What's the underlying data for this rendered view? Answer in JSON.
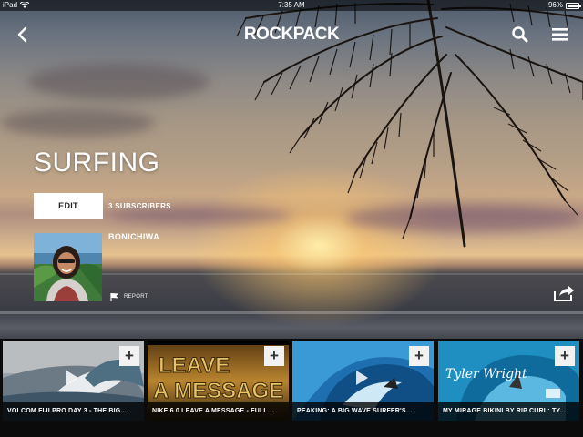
{
  "status_bar": {
    "device": "iPad",
    "time": "7:35 AM",
    "battery": "96%"
  },
  "header": {
    "logo": "ROCKPACK",
    "icons": [
      "back-arrow-icon",
      "search-icon",
      "menu-icon"
    ]
  },
  "channel": {
    "title": "SURFING",
    "edit_label": "EDIT",
    "subscribers": "3 SUBSCRIBERS",
    "owner": "BONICHIWA",
    "report_label": "REPORT"
  },
  "videos": [
    {
      "title": "VOLCOM FIJI PRO DAY 3 - THE BIG...",
      "add_label": "+"
    },
    {
      "title": "NIKE 6.0 LEAVE A MESSAGE - FULL...",
      "add_label": "+",
      "thumb_text_1": "LEAVE",
      "thumb_text_2": "A MESSAGE"
    },
    {
      "title": "PEAKING: A BIG WAVE SURFER'S...",
      "add_label": "+"
    },
    {
      "title": "MY MIRAGE BIKINI BY RIP CURL: TY...",
      "add_label": "+",
      "thumb_text": "Tyler Wright"
    }
  ],
  "colors": {
    "accent_text": "#ffffff",
    "button_bg": "#ffffff",
    "strip_bg": "#0b0b0c"
  }
}
